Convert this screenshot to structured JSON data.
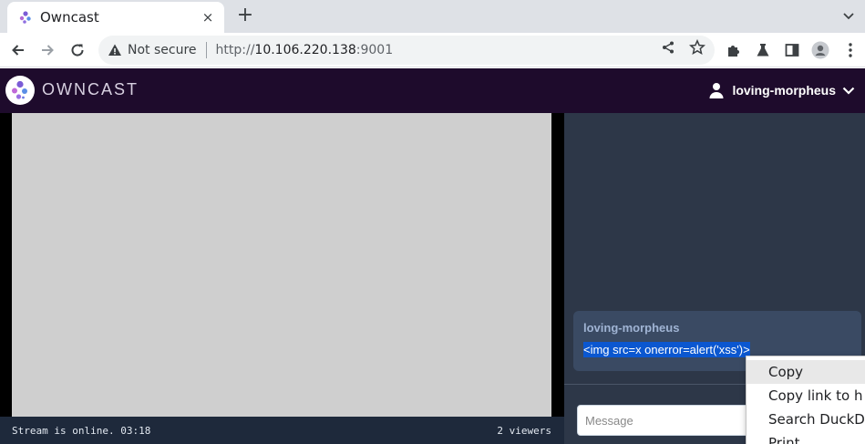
{
  "browser": {
    "tab": {
      "title": "Owncast",
      "favicon": "owncast-icon",
      "close_glyph": "×"
    },
    "new_tab_glyph": "+",
    "omnibox": {
      "security_label": "Not secure",
      "url_scheme": "http://",
      "url_host": "10.106.220.138",
      "url_port": ":9001"
    },
    "toolbar_icons": [
      "back-icon",
      "forward-icon",
      "reload-icon",
      "share-icon",
      "star-icon",
      "extensions-icon",
      "labs-icon",
      "side-panel-icon",
      "profile-icon",
      "more-icon"
    ]
  },
  "site": {
    "title": "OWNCAST",
    "user": {
      "name": "loving-morpheus"
    }
  },
  "player": {
    "status": "Stream is online. 03:18",
    "viewers": "2 viewers"
  },
  "chat": {
    "messages": [
      {
        "author": "loving-morpheus",
        "body": "<img src=x onerror=alert('xss')>"
      }
    ],
    "input_placeholder": "Message"
  },
  "context_menu": {
    "items": [
      "Copy",
      "Copy link to h",
      "Search DuckD",
      "Print"
    ]
  },
  "colors": {
    "header_bg": "#1e0b2c",
    "chat_bg": "#2d3748",
    "status_bg": "#1e293b",
    "selection": "#0b57d0"
  }
}
